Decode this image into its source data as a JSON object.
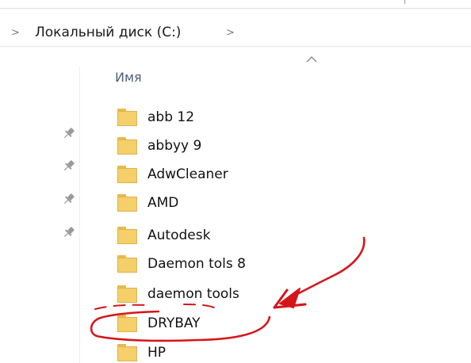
{
  "address_bar": {
    "separator": ">",
    "location": "Локальный диск (C:)"
  },
  "header": {
    "name_column": "Имя"
  },
  "folders": [
    {
      "name": "abb 12"
    },
    {
      "name": "abbyy 9"
    },
    {
      "name": "AdwCleaner"
    },
    {
      "name": "AMD"
    },
    {
      "name": "Autodesk"
    },
    {
      "name": "Daemon tols 8"
    },
    {
      "name": "daemon tools"
    },
    {
      "name": "DRYBAY"
    },
    {
      "name": "HP"
    }
  ],
  "icons": {
    "folder": "folder-icon",
    "pin": "pin-icon",
    "sort": "sort-ascending-icon",
    "chevron": "chevron-right-icon"
  },
  "colors": {
    "folder_fill": "#f4cf6a",
    "folder_tab": "#e7b94f",
    "annotation": "#d4161c",
    "header_text": "#4c607a"
  }
}
